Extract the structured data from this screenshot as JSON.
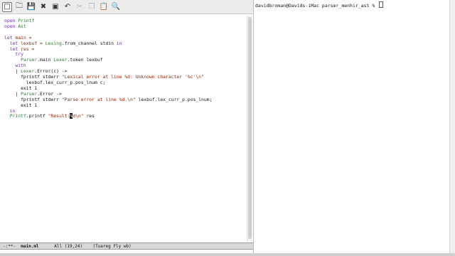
{
  "toolbar": {
    "icons": [
      "new-file-icon",
      "open-folder-icon",
      "save-icon",
      "close-icon",
      "save-as-icon",
      "undo-icon",
      "cut-icon",
      "copy-icon",
      "paste-icon",
      "search-icon"
    ]
  },
  "code": {
    "l1a": "open",
    "l1b": "Printf",
    "l2a": "open",
    "l2b": "Ast",
    "l4a": "let",
    "l4b": "main =",
    "l5a": "  let",
    "l5b": "lexbuf = ",
    "l5c": "Lexing",
    "l5d": ".from_channel stdin ",
    "l5e": "in",
    "l6a": "  let",
    "l6b": "res =",
    "l7a": "    try",
    "l8a": "      ",
    "l8b": "Parser",
    "l8c": ".main ",
    "l8d": "Lexer",
    "l8e": ".token lexbuf",
    "l9a": "    with",
    "l10a": "    | ",
    "l10b": "Lexer",
    "l10c": ".Error(c) ->",
    "l11a": "      fprintf stderr ",
    "l11b": "\"Lexical error at line %d: Unknown character '%c'\\n\"",
    "l12a": "        lexbuf.lex_curr_p.pos_lnum c;",
    "l13a": "      exit 1",
    "l14a": "    | ",
    "l14b": "Parser",
    "l14c": ".Error ->",
    "l15a": "      fprintf stderr ",
    "l15b": "\"Parse error at line %d.\\n\"",
    "l15c": " lexbuf.lex_curr_p.pos_lnum;",
    "l16a": "      exit 1",
    "l17a": "  in",
    "l18a": "  ",
    "l18b": "Printf",
    "l18c": ".printf ",
    "l18d": "\"Result:",
    "l18e": "%",
    "l18f": "d\\n\"",
    "l18g": " res"
  },
  "modeline": {
    "status": "-:**-  ",
    "buffer": "main.ml",
    "position": "      All (19,24)    (Tuareg Fly wb)"
  },
  "terminal": {
    "prompt": "davidbroman@Davids-iMac parser_menhir_ast % "
  }
}
